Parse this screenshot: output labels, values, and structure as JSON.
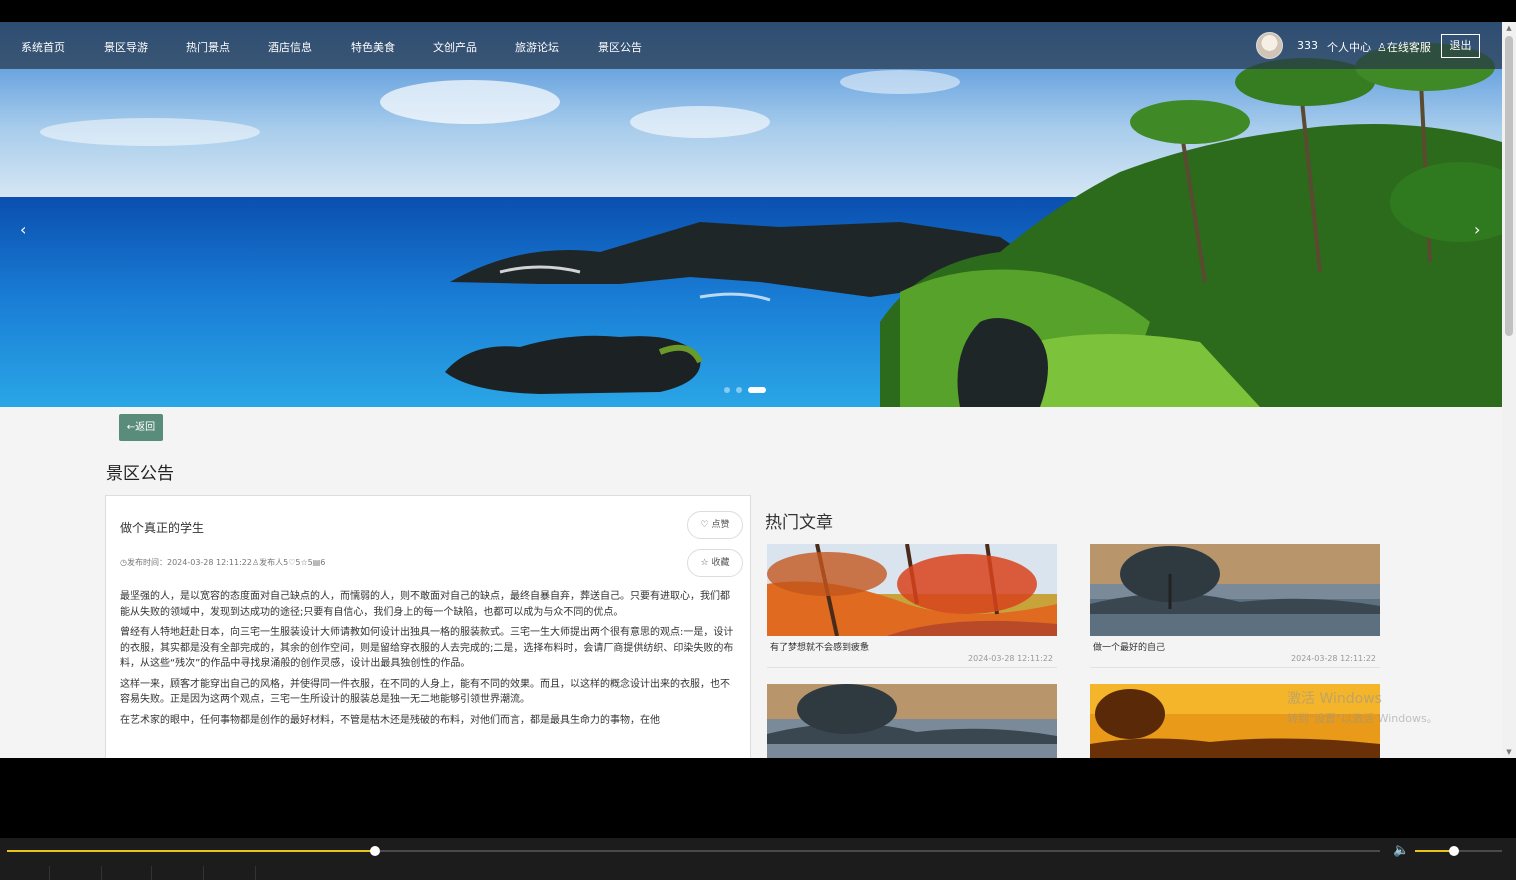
{
  "nav": {
    "items": [
      "系统首页",
      "景区导游",
      "热门景点",
      "酒店信息",
      "特色美食",
      "文创产品",
      "旅游论坛",
      "景区公告"
    ],
    "username": "333",
    "personal_center": "个人中心",
    "online_service": "在线客服",
    "logout": "退出"
  },
  "banner": {
    "prev": "‹",
    "next": "›",
    "dot_count": 3,
    "active_dot": 3
  },
  "back_button": "←返回",
  "page_title": "景区公告",
  "article": {
    "title": "做个真正的学生",
    "meta": "◷发布时间：2024-03-28 12:11:22♙发布人5♡5☆5▤6",
    "like": "♡ 点赞",
    "favorite": "☆ 收藏",
    "paragraphs": [
      "最坚强的人，是以宽容的态度面对自己缺点的人，而懦弱的人，则不敢面对自己的缺点，最终自暴自弃，葬送自己。只要有进取心，我们都能从失败的领域中，发现到达成功的途径;只要有自信心，我们身上的每一个缺陷，也都可以成为与众不同的优点。",
      "曾经有人特地赶赴日本，向三宅一生服装设计大师请教如何设计出独具一格的服装款式。三宅一生大师提出两个很有意思的观点:一是，设计的衣服，其实都是没有全部完成的，其余的创作空间，则是留给穿衣服的人去完成的;二是，选择布料时，会请厂商提供纺织、印染失败的布料，从这些“残次”的作品中寻找泉涌般的创作灵感，设计出最具独创性的作品。",
      "这样一来，顾客才能穿出自己的风格，并使得同一件衣服，在不同的人身上，能有不同的效果。而且，以这样的概念设计出来的衣服，也不容易失败。正是因为这两个观点，三宅一生所设计的服装总是独一无二地能够引领世界潮流。",
      "在艺术家的眼中，任何事物都是创作的最好材料，不管是枯木还是残破的布料，对他们而言，都是最具生命力的事物，在他"
    ]
  },
  "hot": {
    "title": "热门文章",
    "cards": [
      {
        "caption": "有了梦想就不会感到疲惫",
        "date": "2024-03-28 12:11:22"
      },
      {
        "caption": "做一个最好的自己",
        "date": "2024-03-28 12:11:22"
      },
      {
        "caption": "",
        "date": ""
      },
      {
        "caption": "",
        "date": ""
      }
    ]
  },
  "watermark": {
    "line1": "激活 Windows",
    "line2": "转到\"设置\"以激活 Windows。"
  },
  "player": {
    "progress": 0.268,
    "volume": 0.45
  },
  "colors": {
    "nav_bg": "#28374b",
    "back_button": "#5a8c7c",
    "progress": "#e8c21d"
  }
}
